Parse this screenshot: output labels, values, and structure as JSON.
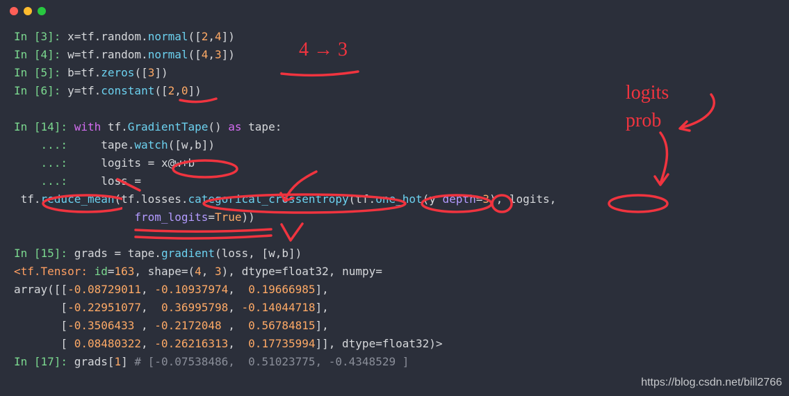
{
  "annotations": {
    "top_arrow_text": "4 → 3",
    "right_note_line1": "logits",
    "right_note_line2": "prob"
  },
  "watermark": "https://blog.csdn.net/bill2766",
  "lines": [
    {
      "kind": "code",
      "segments": [
        {
          "t": "In [",
          "c": "prompt"
        },
        {
          "t": "3",
          "c": "prompt"
        },
        {
          "t": "]: ",
          "c": "prompt"
        },
        {
          "t": "x",
          "c": "plain"
        },
        {
          "t": "=",
          "c": "plain"
        },
        {
          "t": "tf.random.",
          "c": "plain"
        },
        {
          "t": "normal",
          "c": "call"
        },
        {
          "t": "([",
          "c": "plain"
        },
        {
          "t": "2",
          "c": "num"
        },
        {
          "t": ",",
          "c": "plain"
        },
        {
          "t": "4",
          "c": "num"
        },
        {
          "t": "])",
          "c": "plain"
        }
      ]
    },
    {
      "kind": "code",
      "segments": [
        {
          "t": "In [",
          "c": "prompt"
        },
        {
          "t": "4",
          "c": "prompt"
        },
        {
          "t": "]: ",
          "c": "prompt"
        },
        {
          "t": "w",
          "c": "plain"
        },
        {
          "t": "=",
          "c": "plain"
        },
        {
          "t": "tf.random.",
          "c": "plain"
        },
        {
          "t": "normal",
          "c": "call"
        },
        {
          "t": "([",
          "c": "plain"
        },
        {
          "t": "4",
          "c": "num"
        },
        {
          "t": ",",
          "c": "plain"
        },
        {
          "t": "3",
          "c": "num"
        },
        {
          "t": "])",
          "c": "plain"
        }
      ]
    },
    {
      "kind": "code",
      "segments": [
        {
          "t": "In [",
          "c": "prompt"
        },
        {
          "t": "5",
          "c": "prompt"
        },
        {
          "t": "]: ",
          "c": "prompt"
        },
        {
          "t": "b",
          "c": "plain"
        },
        {
          "t": "=",
          "c": "plain"
        },
        {
          "t": "tf.",
          "c": "plain"
        },
        {
          "t": "zeros",
          "c": "call"
        },
        {
          "t": "([",
          "c": "plain"
        },
        {
          "t": "3",
          "c": "num"
        },
        {
          "t": "])",
          "c": "plain"
        }
      ]
    },
    {
      "kind": "code",
      "segments": [
        {
          "t": "In [",
          "c": "prompt"
        },
        {
          "t": "6",
          "c": "prompt"
        },
        {
          "t": "]: ",
          "c": "prompt"
        },
        {
          "t": "y",
          "c": "plain"
        },
        {
          "t": "=",
          "c": "plain"
        },
        {
          "t": "tf.",
          "c": "plain"
        },
        {
          "t": "constant",
          "c": "call"
        },
        {
          "t": "([",
          "c": "plain"
        },
        {
          "t": "2",
          "c": "num"
        },
        {
          "t": ",",
          "c": "plain"
        },
        {
          "t": "0",
          "c": "num"
        },
        {
          "t": "])",
          "c": "plain"
        }
      ]
    },
    {
      "kind": "blank"
    },
    {
      "kind": "code",
      "segments": [
        {
          "t": "In [",
          "c": "prompt"
        },
        {
          "t": "14",
          "c": "prompt"
        },
        {
          "t": "]: ",
          "c": "prompt"
        },
        {
          "t": "with",
          "c": "kw"
        },
        {
          "t": " tf.",
          "c": "plain"
        },
        {
          "t": "GradientTape",
          "c": "call"
        },
        {
          "t": "() ",
          "c": "plain"
        },
        {
          "t": "as",
          "c": "kw"
        },
        {
          "t": " tape:",
          "c": "plain"
        }
      ]
    },
    {
      "kind": "code",
      "segments": [
        {
          "t": "    ...:     ",
          "c": "prompt"
        },
        {
          "t": "tape.",
          "c": "plain"
        },
        {
          "t": "watch",
          "c": "call"
        },
        {
          "t": "([w,b])",
          "c": "plain"
        }
      ]
    },
    {
      "kind": "code",
      "segments": [
        {
          "t": "    ...:     ",
          "c": "prompt"
        },
        {
          "t": "logits ",
          "c": "plain"
        },
        {
          "t": "=",
          "c": "plain"
        },
        {
          "t": " x",
          "c": "plain"
        },
        {
          "t": "@",
          "c": "plain"
        },
        {
          "t": "w",
          "c": "plain"
        },
        {
          "t": "+",
          "c": "plain"
        },
        {
          "t": "b",
          "c": "plain"
        }
      ]
    },
    {
      "kind": "code",
      "segments": [
        {
          "t": "    ...:     ",
          "c": "prompt"
        },
        {
          "t": "loss ",
          "c": "plain"
        },
        {
          "t": "=",
          "c": "plain"
        }
      ]
    },
    {
      "kind": "code",
      "segments": [
        {
          "t": " tf.",
          "c": "plain"
        },
        {
          "t": "reduce_mean",
          "c": "call"
        },
        {
          "t": "(tf.losses.",
          "c": "plain"
        },
        {
          "t": "categorical_crossentropy",
          "c": "call"
        },
        {
          "t": "(tf.",
          "c": "plain"
        },
        {
          "t": "one_hot",
          "c": "call"
        },
        {
          "t": "(y ",
          "c": "plain"
        },
        {
          "t": "depth",
          "c": "param"
        },
        {
          "t": "=",
          "c": "plain"
        },
        {
          "t": "3",
          "c": "num"
        },
        {
          "t": "), logits,",
          "c": "plain"
        }
      ]
    },
    {
      "kind": "code",
      "segments": [
        {
          "t": "                  ",
          "c": "plain"
        },
        {
          "t": "from_logits",
          "c": "param"
        },
        {
          "t": "=",
          "c": "plain"
        },
        {
          "t": "True",
          "c": "bool"
        },
        {
          "t": "))",
          "c": "plain"
        }
      ]
    },
    {
      "kind": "blank"
    },
    {
      "kind": "code",
      "segments": [
        {
          "t": "In [",
          "c": "prompt"
        },
        {
          "t": "15",
          "c": "prompt"
        },
        {
          "t": "]: ",
          "c": "prompt"
        },
        {
          "t": "grads ",
          "c": "plain"
        },
        {
          "t": "=",
          "c": "plain"
        },
        {
          "t": " tape.",
          "c": "plain"
        },
        {
          "t": "gradient",
          "c": "call"
        },
        {
          "t": "(loss, [w,b])",
          "c": "plain"
        }
      ]
    },
    {
      "kind": "code",
      "segments": [
        {
          "t": "<tf.Tensor: ",
          "c": "tensor"
        },
        {
          "t": "id",
          "c": "tensorkey"
        },
        {
          "t": "=",
          "c": "plain"
        },
        {
          "t": "163",
          "c": "num"
        },
        {
          "t": ", ",
          "c": "plain"
        },
        {
          "t": "shape",
          "c": "plain"
        },
        {
          "t": "=(",
          "c": "plain"
        },
        {
          "t": "4",
          "c": "num"
        },
        {
          "t": ", ",
          "c": "plain"
        },
        {
          "t": "3",
          "c": "num"
        },
        {
          "t": "), ",
          "c": "plain"
        },
        {
          "t": "dtype",
          "c": "plain"
        },
        {
          "t": "=float32, ",
          "c": "plain"
        },
        {
          "t": "numpy",
          "c": "plain"
        },
        {
          "t": "=",
          "c": "plain"
        }
      ]
    },
    {
      "kind": "code",
      "segments": [
        {
          "t": "array",
          "c": "plain"
        },
        {
          "t": "([[",
          "c": "plain"
        },
        {
          "t": "-0.08729011",
          "c": "num"
        },
        {
          "t": ", ",
          "c": "plain"
        },
        {
          "t": "-0.10937974",
          "c": "num"
        },
        {
          "t": ",  ",
          "c": "plain"
        },
        {
          "t": "0.19666985",
          "c": "num"
        },
        {
          "t": "],",
          "c": "plain"
        }
      ]
    },
    {
      "kind": "code",
      "segments": [
        {
          "t": "       [",
          "c": "plain"
        },
        {
          "t": "-0.22951077",
          "c": "num"
        },
        {
          "t": ",  ",
          "c": "plain"
        },
        {
          "t": "0.36995798",
          "c": "num"
        },
        {
          "t": ", ",
          "c": "plain"
        },
        {
          "t": "-0.14044718",
          "c": "num"
        },
        {
          "t": "],",
          "c": "plain"
        }
      ]
    },
    {
      "kind": "code",
      "segments": [
        {
          "t": "       [",
          "c": "plain"
        },
        {
          "t": "-0.3506433 ",
          "c": "num"
        },
        {
          "t": ", ",
          "c": "plain"
        },
        {
          "t": "-0.2172048 ",
          "c": "num"
        },
        {
          "t": ",  ",
          "c": "plain"
        },
        {
          "t": "0.56784815",
          "c": "num"
        },
        {
          "t": "],",
          "c": "plain"
        }
      ]
    },
    {
      "kind": "code",
      "segments": [
        {
          "t": "       [ ",
          "c": "plain"
        },
        {
          "t": "0.08480322",
          "c": "num"
        },
        {
          "t": ", ",
          "c": "plain"
        },
        {
          "t": "-0.26216313",
          "c": "num"
        },
        {
          "t": ",  ",
          "c": "plain"
        },
        {
          "t": "0.17735994",
          "c": "num"
        },
        {
          "t": "]], dtype",
          "c": "plain"
        },
        {
          "t": "=",
          "c": "plain"
        },
        {
          "t": "float32)>",
          "c": "plain"
        }
      ]
    },
    {
      "kind": "code",
      "segments": [
        {
          "t": "In [",
          "c": "prompt"
        },
        {
          "t": "17",
          "c": "prompt"
        },
        {
          "t": "]: ",
          "c": "prompt"
        },
        {
          "t": "grads[",
          "c": "plain"
        },
        {
          "t": "1",
          "c": "num"
        },
        {
          "t": "] ",
          "c": "plain"
        },
        {
          "t": "# [-0.07538486,  0.51023775, -0.4348529 ]",
          "c": "comment"
        }
      ]
    }
  ]
}
